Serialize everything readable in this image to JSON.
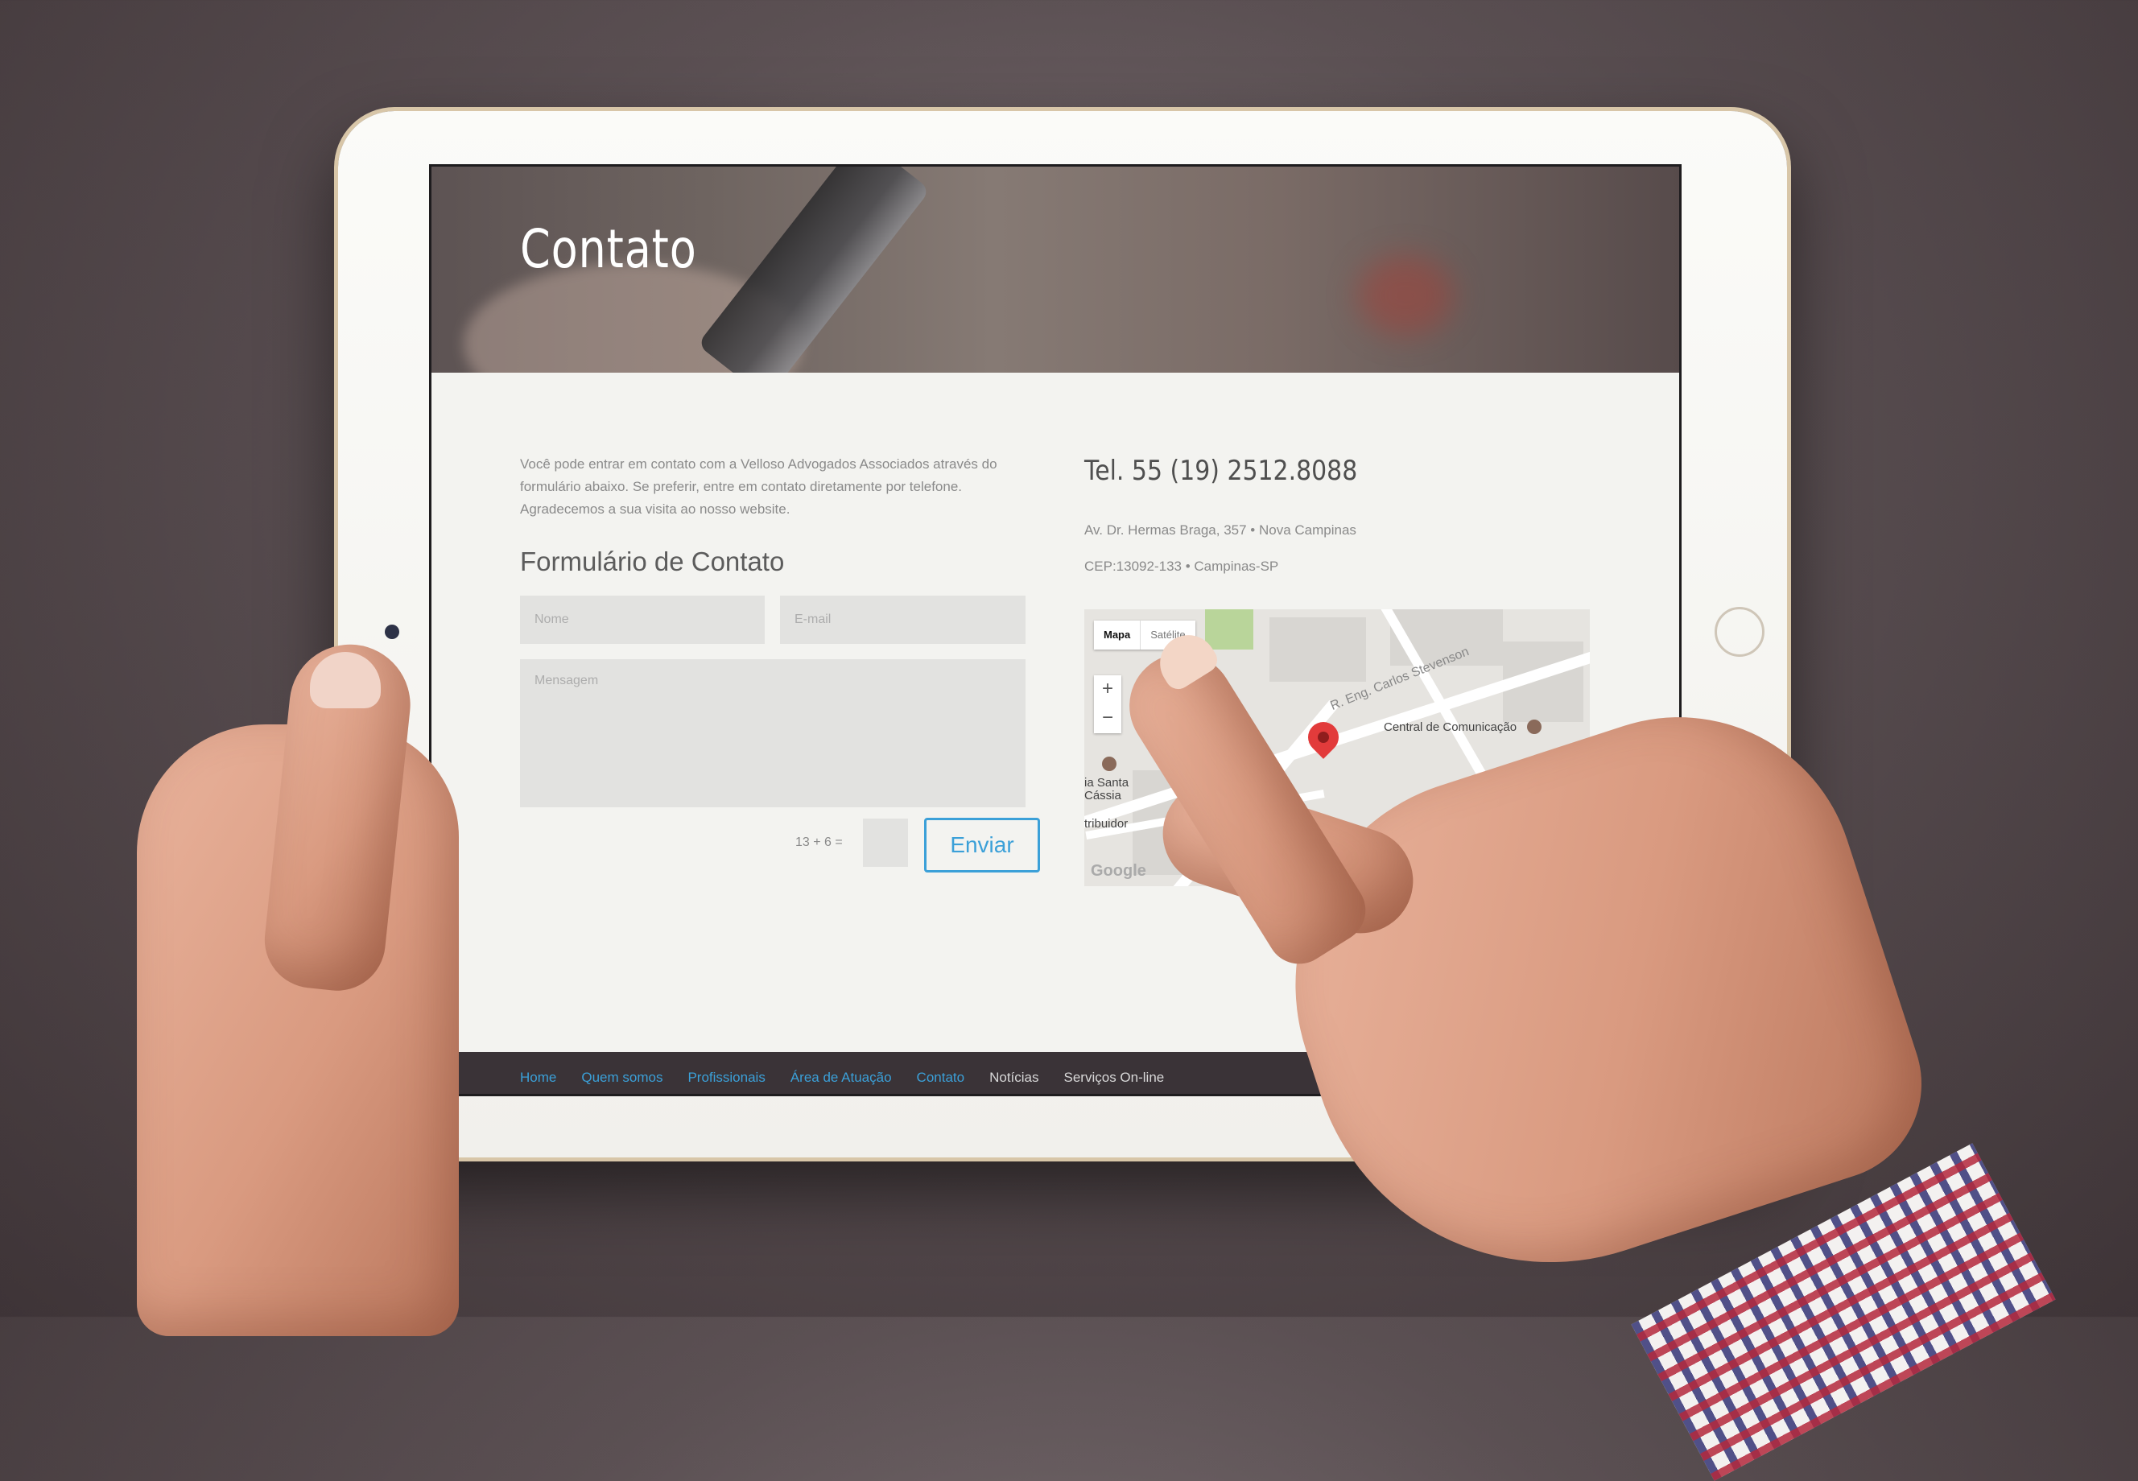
{
  "hero": {
    "title": "Contato"
  },
  "contact": {
    "intro": "Você pode entrar em contato com a Velloso Advogados Associados através do formulário abaixo. Se preferir, entre em contato diretamente por telefone. Agradecemos a sua visita ao nosso website.",
    "form_title": "Formulário de Contato",
    "name_placeholder": "Nome",
    "email_placeholder": "E-mail",
    "message_placeholder": "Mensagem",
    "captcha_question": "13 + 6 =",
    "submit_label": "Enviar"
  },
  "info": {
    "phone": "Tel. 55 (19) 2512.8088",
    "address_line1": "Av. Dr. Hermas Braga, 357 • Nova Campinas",
    "address_line2": "CEP:13092-133 • Campinas-SP"
  },
  "map": {
    "type_map": "Mapa",
    "type_satellite": "Satélite",
    "zoom_in": "+",
    "zoom_out": "−",
    "label_central": "Central de Comunicação",
    "label_street": "R. Eng. Carlos Stevenson",
    "label_santa": "ia Santa\nCássia",
    "label_distribuidor": "tribuidor",
    "google": "Google"
  },
  "footer": {
    "nav": [
      {
        "label": "Home"
      },
      {
        "label": "Quem somos"
      },
      {
        "label": "Profissionais"
      },
      {
        "label": "Área de Atuação"
      },
      {
        "label": "Contato"
      },
      {
        "label": "Notícias"
      },
      {
        "label": "Serviços On-line"
      }
    ]
  },
  "colors": {
    "accent": "#3ba0d8",
    "footer_bg": "#3a3337",
    "input_bg": "#e2e2e0"
  }
}
